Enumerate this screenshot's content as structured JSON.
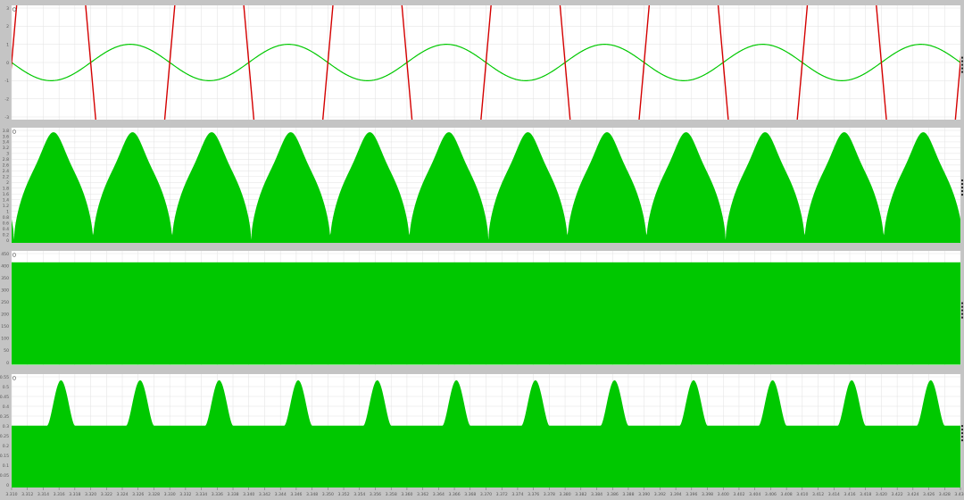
{
  "colors": {
    "background": "#c4c4c4",
    "plot_background": "#ffffff",
    "grid": "#e2e2e2",
    "axis_text": "#555555",
    "series_green": "#00c800",
    "series_red": "#d40000",
    "marker": "#222222"
  },
  "icons": {
    "panel_marker": "circle-icon",
    "cursor_marker": "dotted-cursor-icon"
  },
  "x_axis": {
    "ticks": [
      "3.310",
      "3.312",
      "3.314",
      "3.316",
      "3.318",
      "3.320",
      "3.322",
      "3.324",
      "3.326",
      "3.328",
      "3.330",
      "3.332",
      "3.334",
      "3.336",
      "3.338",
      "3.340",
      "3.342",
      "3.344",
      "3.346",
      "3.348",
      "3.350",
      "3.352",
      "3.354",
      "3.356",
      "3.358",
      "3.360",
      "3.362",
      "3.364",
      "3.366",
      "3.368",
      "3.370",
      "3.372",
      "3.374",
      "3.376",
      "3.378",
      "3.380",
      "3.382",
      "3.384",
      "3.386",
      "3.388",
      "3.390",
      "3.392",
      "3.394",
      "3.396",
      "3.398",
      "3.400",
      "3.402",
      "3.404",
      "3.406",
      "3.408",
      "3.410",
      "3.412",
      "3.414",
      "3.416",
      "3.418",
      "3.420",
      "3.422",
      "3.424",
      "3.426",
      "3.428",
      "3.430"
    ]
  },
  "chart_data": [
    {
      "type": "line",
      "y_ticks": [
        "3",
        "2",
        "1",
        "0",
        "-1",
        "-2",
        "-3"
      ],
      "ylim": [
        -3.3,
        3.3
      ],
      "grid": true,
      "series": [
        {
          "kind": "sine",
          "color": "#00c800",
          "amplitude": 1.05,
          "cycles": 6,
          "phase_deg": 180
        },
        {
          "kind": "steep-zigzag",
          "color": "#d40000",
          "cycles": 6
        }
      ]
    },
    {
      "type": "area",
      "y_ticks": [
        "3.8",
        "3.6",
        "3.4",
        "3.2",
        "3",
        "2.8",
        "2.6",
        "2.4",
        "2.2",
        "2",
        "1.8",
        "1.6",
        "1.4",
        "1.2",
        "1",
        "0.8",
        "0.6",
        "0.4",
        "0.2",
        "0"
      ],
      "ylim": [
        0,
        3.8
      ],
      "grid": true,
      "series": [
        {
          "kind": "rectified-bumps",
          "color": "#00c800",
          "humps": 12,
          "peak": 3.65,
          "shoulder": 2.9,
          "floor": 0.1
        }
      ]
    },
    {
      "type": "area",
      "y_ticks": [
        "450",
        "400",
        "350",
        "300",
        "250",
        "200",
        "150",
        "100",
        "50",
        "0"
      ],
      "ylim": [
        0,
        450
      ],
      "grid": true,
      "series": [
        {
          "kind": "dense-band",
          "color": "#00c800",
          "top": 405,
          "bottom": 2
        }
      ]
    },
    {
      "type": "area",
      "y_ticks": [
        "0.55",
        "0.5",
        "0.45",
        "0.4",
        "0.35",
        "0.3",
        "0.25",
        "0.2",
        "0.15",
        "0.1",
        "0.05",
        "0"
      ],
      "ylim": [
        0,
        0.55
      ],
      "grid": true,
      "series": [
        {
          "kind": "periodic-spikes",
          "color": "#00c800",
          "count": 12,
          "base": 0.3,
          "peak": 0.52
        }
      ]
    }
  ]
}
